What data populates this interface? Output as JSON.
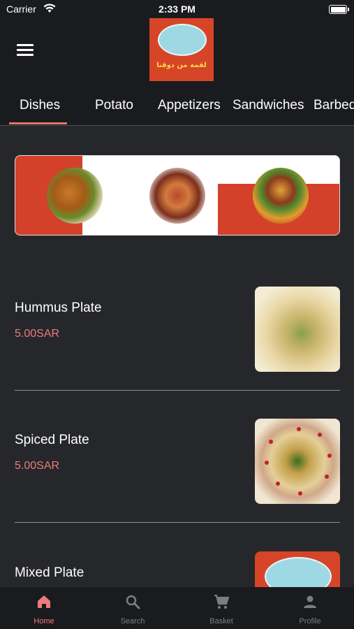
{
  "status_bar": {
    "carrier": "Carrier",
    "time": "2:33 PM"
  },
  "header": {
    "logo_text": "لقمة من دوقنا"
  },
  "tabs": [
    {
      "label": "Dishes",
      "active": true
    },
    {
      "label": "Potato"
    },
    {
      "label": "Appetizers"
    },
    {
      "label": "Sandwiches"
    },
    {
      "label": "Barbeq"
    }
  ],
  "menu_items": [
    {
      "name": "Hummus Plate",
      "price": "5.00SAR"
    },
    {
      "name": "Spiced Plate",
      "price": "5.00SAR"
    },
    {
      "name": "Mixed Plate"
    }
  ],
  "bottom_nav": [
    {
      "label": "Home",
      "icon": "home-icon",
      "active": true
    },
    {
      "label": "Search",
      "icon": "search-icon"
    },
    {
      "label": "Basket",
      "icon": "cart-icon"
    },
    {
      "label": "Profile",
      "icon": "profile-icon"
    }
  ],
  "colors": {
    "accent": "#ec7b7a",
    "background": "#26272b",
    "bar": "#1a1b1e",
    "brand_red": "#d64527"
  }
}
